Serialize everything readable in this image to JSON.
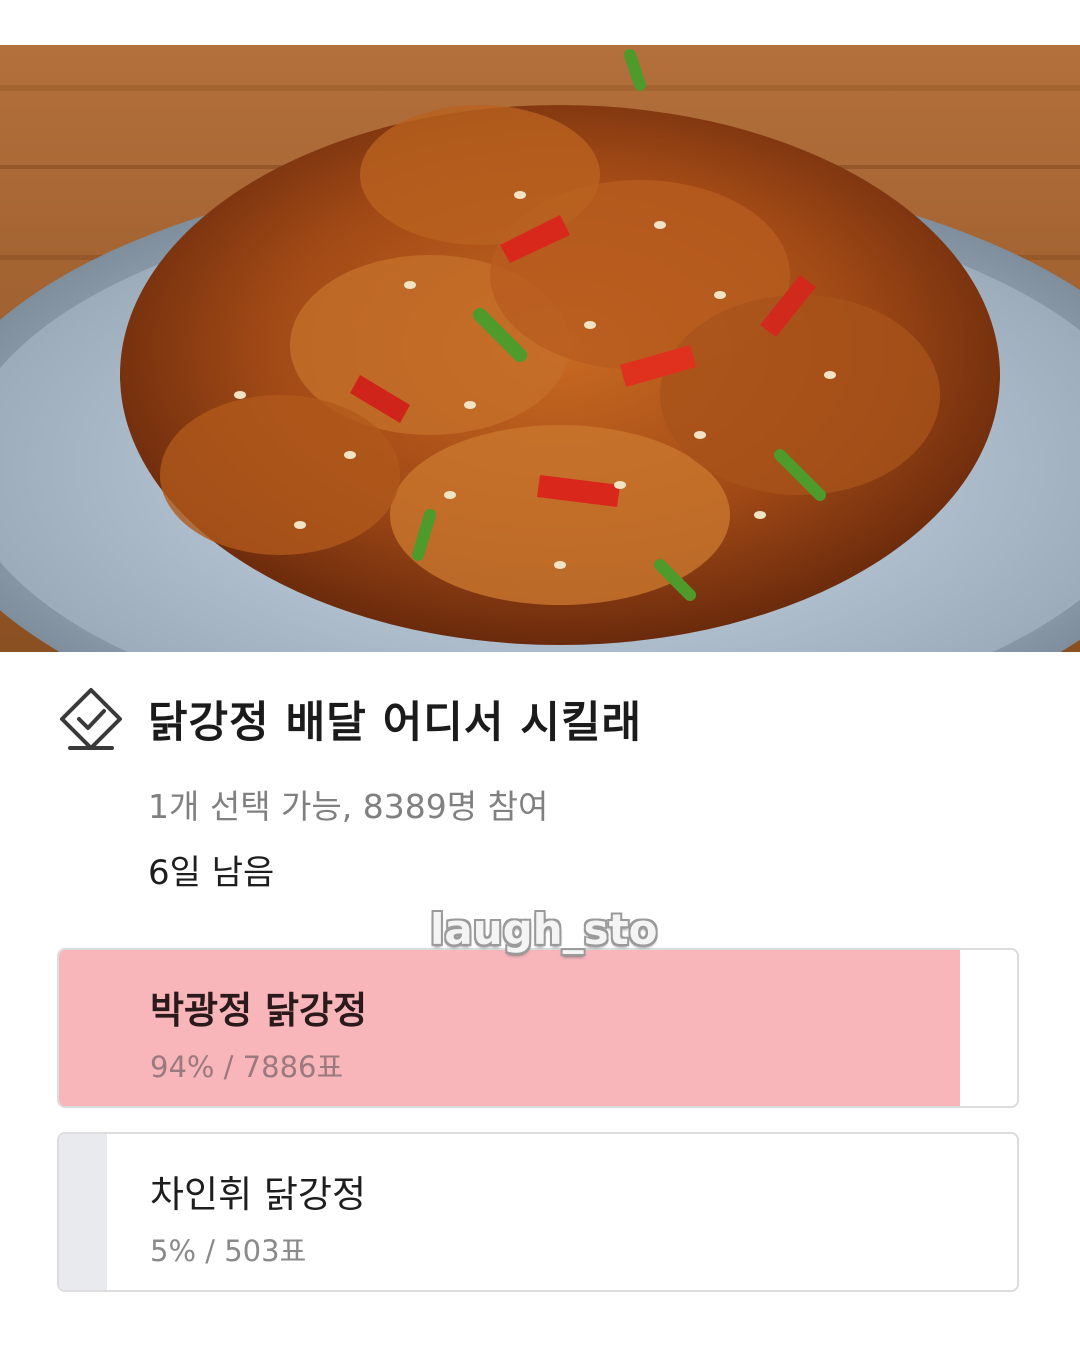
{
  "photo": {
    "icon": "dakgangjeong-photo"
  },
  "poll": {
    "icon": "poll-check-icon",
    "title": "닭강정 배달 어디서 시킬래",
    "meta": "1개 선택 가능, 8389명 참여",
    "remaining": "6일 남음",
    "options": [
      {
        "label": "박광정 닭강정",
        "stat": "94% / 7886표",
        "percent": 94,
        "votes": 7886,
        "selected": true
      },
      {
        "label": "차인휘 닭강정",
        "stat": "5% / 503표",
        "percent": 5,
        "votes": 503,
        "selected": false
      }
    ]
  },
  "watermark": "laugh_sto",
  "colors": {
    "selected_fill": "#f8b6bb",
    "unselected_fill": "#e9eaee",
    "border": "#dcdcdc"
  }
}
